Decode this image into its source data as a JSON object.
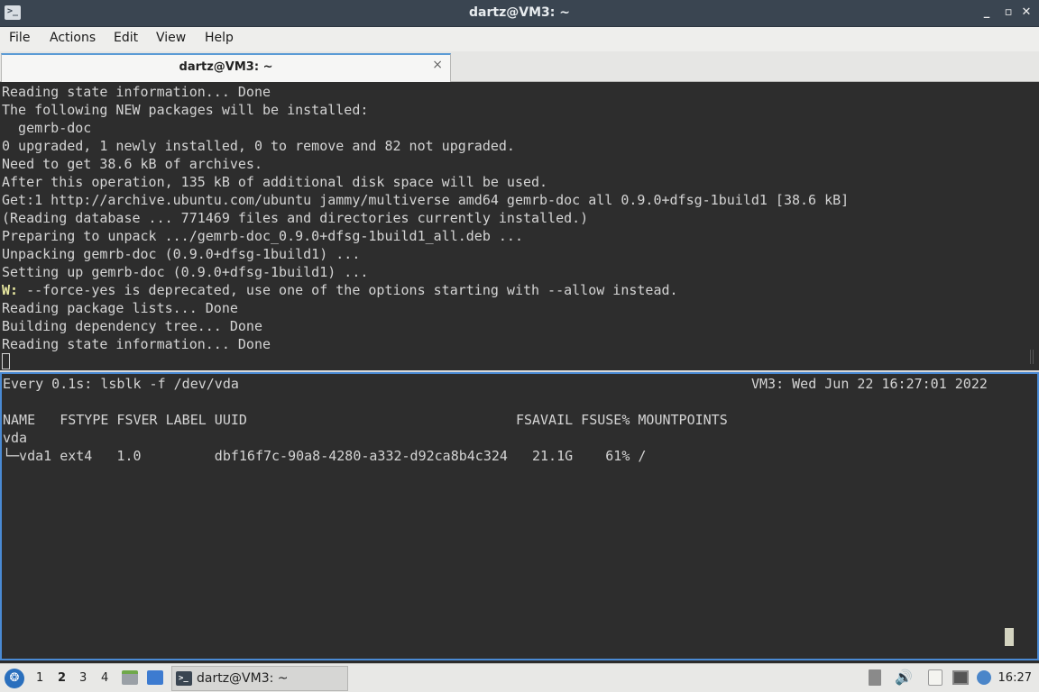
{
  "window": {
    "title": "dartz@VM3: ~",
    "minimize_glyph": "_",
    "maximize_glyph": "▫",
    "close_glyph": "✕"
  },
  "menubar": {
    "items": [
      "File",
      "Actions",
      "Edit",
      "View",
      "Help"
    ]
  },
  "tabs": [
    {
      "label": "dartz@VM3: ~",
      "close_glyph": "×"
    }
  ],
  "pane_top": {
    "lines": [
      "Reading state information... Done",
      "The following NEW packages will be installed:",
      "  gemrb-doc",
      "0 upgraded, 1 newly installed, 0 to remove and 82 not upgraded.",
      "Need to get 38.6 kB of archives.",
      "After this operation, 135 kB of additional disk space will be used.",
      "Get:1 http://archive.ubuntu.com/ubuntu jammy/multiverse amd64 gemrb-doc all 0.9.0+dfsg-1build1 [38.6 kB]",
      "(Reading database ... 771469 files and directories currently installed.)",
      "Preparing to unpack .../gemrb-doc_0.9.0+dfsg-1build1_all.deb ...",
      "Unpacking gemrb-doc (0.9.0+dfsg-1build1) ...",
      "Setting up gemrb-doc (0.9.0+dfsg-1build1) ..."
    ],
    "warn_prefix": "W:",
    "warn_text": " --force-yes is deprecated, use one of the options starting with --allow instead.",
    "lines_after": [
      "Reading package lists... Done",
      "Building dependency tree... Done",
      "Reading state information... Done"
    ]
  },
  "pane_bottom": {
    "watch_cmd": "Every 0.1s: lsblk -f /dev/vda",
    "watch_status": "VM3: Wed Jun 22 16:27:01 2022",
    "table_header": "NAME   FSTYPE FSVER LABEL UUID                                 FSAVAIL FSUSE% MOUNTPOINTS",
    "rows": [
      "vda",
      "└─vda1 ext4   1.0         dbf16f7c-90a8-4280-a332-d92ca8b4c324   21.1G    61% /"
    ]
  },
  "taskbar": {
    "start_glyph": "❂",
    "desktops": [
      "1",
      "2",
      "3",
      "4"
    ],
    "active_desktop": "2",
    "task_label": "dartz@VM3: ~",
    "task_icon_glyph": ">_",
    "clock": "16:27",
    "tray_icons": [
      "updates-icon",
      "volume-icon",
      "clipboard-icon",
      "network-icon",
      "notification-icon"
    ]
  },
  "colors": {
    "titlebar": "#3a4551",
    "terminal_bg": "#2d2d2d",
    "terminal_fg": "#d4d4d4",
    "active_pane_border": "#4a8ad4"
  }
}
